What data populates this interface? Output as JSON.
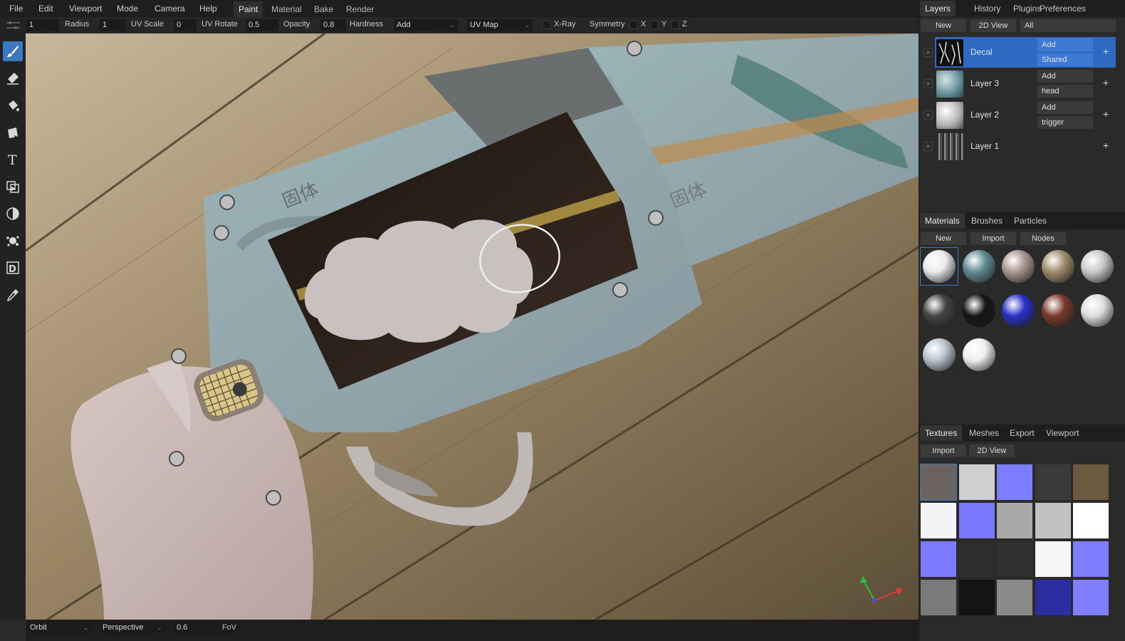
{
  "menu": {
    "file": "File",
    "edit": "Edit",
    "viewport": "Viewport",
    "mode": "Mode",
    "camera": "Camera",
    "help": "Help"
  },
  "workspace_tabs": [
    "Paint",
    "Material",
    "Bake",
    "Render"
  ],
  "tool_options": {
    "radius_value": "1",
    "radius_label": "Radius",
    "uvscale_value": "1",
    "uvscale_label": "UV Scale",
    "uvrotate_value": "0",
    "uvrotate_label": "UV Rotate",
    "opacity_value": "0.5",
    "opacity_label": "Opacity",
    "hardness_value": "0.8",
    "hardness_label": "Hardness",
    "blend_value": "Add",
    "uvmap_value": "UV Map",
    "xray_label": "X-Ray",
    "symmetry_label": "Symmetry",
    "sym_x": "X",
    "sym_y": "Y",
    "sym_z": "Z"
  },
  "tools": [
    "brush-icon",
    "eraser-icon",
    "fill-icon",
    "decal-icon",
    "text-icon",
    "clone-icon",
    "blur-icon",
    "particle-icon",
    "colorid-icon",
    "picker-icon"
  ],
  "layers_panel": {
    "tabs": [
      "Layers",
      "History",
      "Plugins",
      "Preferences"
    ],
    "new_button": "New",
    "view2d_button": "2D View",
    "filter_value": "All",
    "layers": [
      {
        "name": "Decal",
        "blend": "Add",
        "mask": "Shared",
        "selected": true
      },
      {
        "name": "Layer 3",
        "blend": "Add",
        "mask": "head",
        "selected": false
      },
      {
        "name": "Layer 2",
        "blend": "Add",
        "mask": "trigger",
        "selected": false
      },
      {
        "name": "Layer 1",
        "blend": "",
        "mask": "",
        "selected": false
      }
    ],
    "plus": "+",
    "close": "×"
  },
  "materials_panel": {
    "tabs": [
      "Materials",
      "Brushes",
      "Particles"
    ],
    "new_button": "New",
    "import_button": "Import",
    "nodes_button": "Nodes",
    "swatch_colors": [
      "#e9e9e9",
      "#5f8c93",
      "#a8988f",
      "#a08c6c",
      "#c9c9c9",
      "#444444",
      "#151515",
      "#2a31c8",
      "#7a3a2c",
      "#dddddd",
      "#b9c4cc",
      "#efefef"
    ]
  },
  "textures_panel": {
    "tabs": [
      "Textures",
      "Meshes",
      "Export",
      "Viewport"
    ],
    "import_button": "Import",
    "view2d_button": "2D View",
    "texture_colors": [
      "#6b6262",
      "#cfcfcf",
      "#7d7dff",
      "#3a3a3a",
      "#6b5a40",
      "#f4f4f4",
      "#7878ff",
      "#a9a9a9",
      "#c2c2c2",
      "#ffffff",
      "#7b7bff",
      "#2d2d2d",
      "#303030",
      "#f6f6f6",
      "#7d7dff",
      "#7a7a7a",
      "#141414",
      "#8a8a8a",
      "#2b2ea0",
      "#7e7eff"
    ]
  },
  "status": {
    "nav_mode": "Orbit",
    "projection": "Perspective",
    "fov_value": "0.6",
    "fov_label": "FoV"
  },
  "viewport": {
    "engraving_left": "固体",
    "engraving_right": "固体"
  }
}
